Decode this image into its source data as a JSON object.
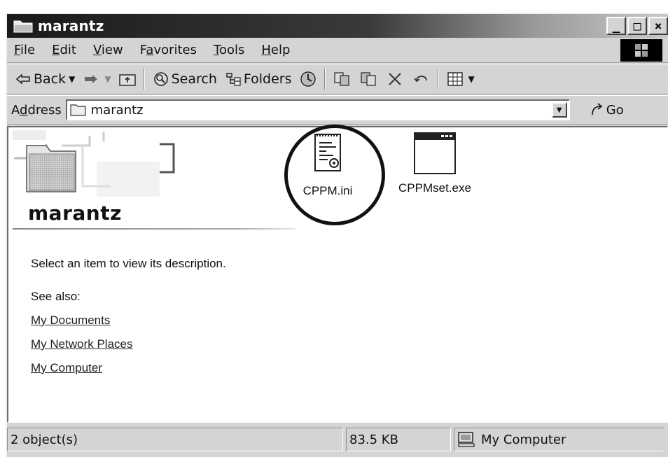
{
  "window": {
    "title": "marantz"
  },
  "menu": [
    {
      "label": "File",
      "key": "F",
      "rest": "ile"
    },
    {
      "label": "Edit",
      "key": "E",
      "rest": "dit"
    },
    {
      "label": "View",
      "key": "V",
      "rest": "iew"
    },
    {
      "label": "Favorites",
      "pre": "F",
      "key": "a",
      "rest": "vorites"
    },
    {
      "label": "Tools",
      "key": "T",
      "rest": "ools"
    },
    {
      "label": "Help",
      "key": "H",
      "rest": "elp"
    }
  ],
  "toolbar": {
    "back_label": "Back",
    "search_label": "Search",
    "folders_label": "Folders"
  },
  "address": {
    "label_pre": "A",
    "label_key": "d",
    "label_rest": "dress",
    "value": "marantz",
    "go_label": "Go"
  },
  "sidebar": {
    "folder_title": "marantz",
    "description": "Select an item to view its description.",
    "see_also": "See also:",
    "links": [
      "My Documents",
      "My Network Places",
      "My Computer"
    ]
  },
  "files": [
    {
      "name": "CPPM.ini",
      "icon": "ini-file-icon",
      "circled": true
    },
    {
      "name": "CPPMset.exe",
      "icon": "exe-file-icon",
      "circled": false
    }
  ],
  "status": {
    "objects": "2 object(s)",
    "size": "83.5 KB",
    "zone": "My Computer"
  }
}
